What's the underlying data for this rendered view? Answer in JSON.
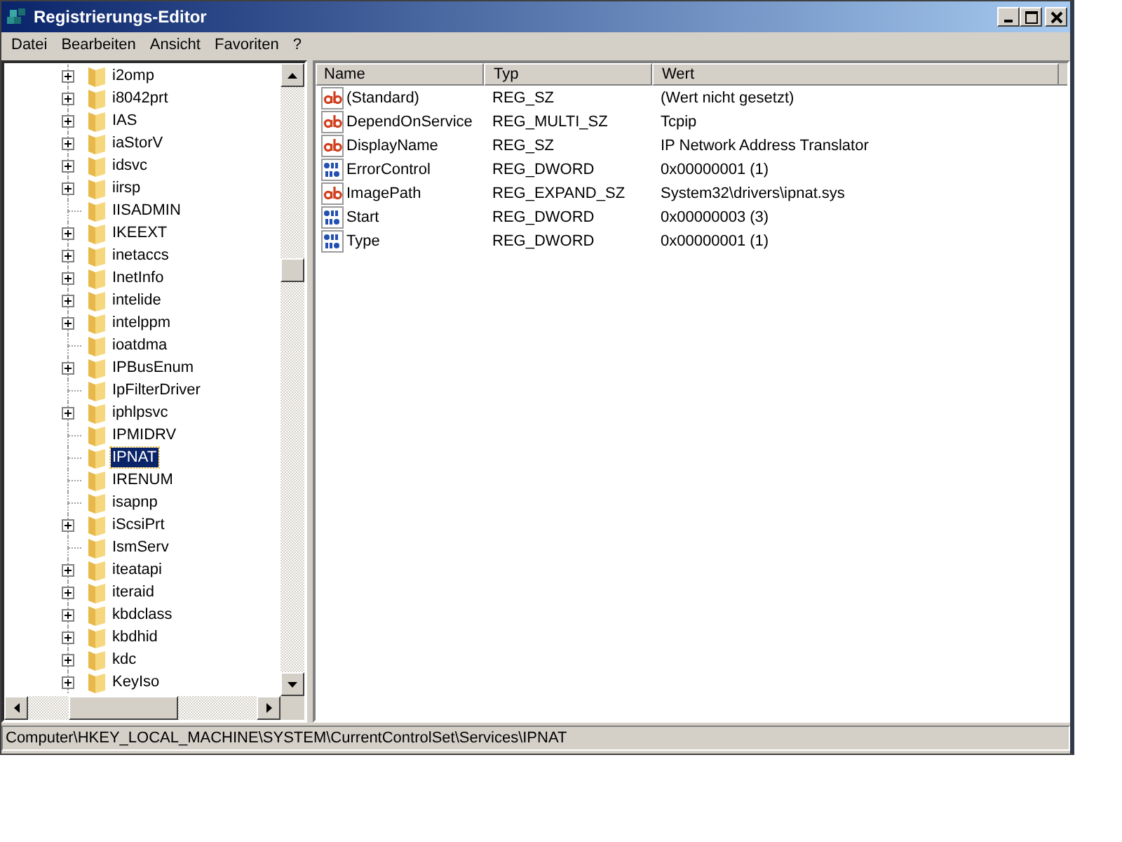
{
  "window": {
    "title": "Registrierungs-Editor"
  },
  "menu": [
    "Datei",
    "Bearbeiten",
    "Ansicht",
    "Favoriten",
    "?"
  ],
  "tree": [
    {
      "label": "i2omp",
      "expandable": true,
      "selected": false
    },
    {
      "label": "i8042prt",
      "expandable": true,
      "selected": false
    },
    {
      "label": "IAS",
      "expandable": true,
      "selected": false
    },
    {
      "label": "iaStorV",
      "expandable": true,
      "selected": false
    },
    {
      "label": "idsvc",
      "expandable": true,
      "selected": false
    },
    {
      "label": "iirsp",
      "expandable": true,
      "selected": false
    },
    {
      "label": "IISADMIN",
      "expandable": false,
      "selected": false
    },
    {
      "label": "IKEEXT",
      "expandable": true,
      "selected": false
    },
    {
      "label": "inetaccs",
      "expandable": true,
      "selected": false
    },
    {
      "label": "InetInfo",
      "expandable": true,
      "selected": false
    },
    {
      "label": "intelide",
      "expandable": true,
      "selected": false
    },
    {
      "label": "intelppm",
      "expandable": true,
      "selected": false
    },
    {
      "label": "ioatdma",
      "expandable": false,
      "selected": false
    },
    {
      "label": "IPBusEnum",
      "expandable": true,
      "selected": false
    },
    {
      "label": "IpFilterDriver",
      "expandable": false,
      "selected": false
    },
    {
      "label": "iphlpsvc",
      "expandable": true,
      "selected": false
    },
    {
      "label": "IPMIDRV",
      "expandable": false,
      "selected": false
    },
    {
      "label": "IPNAT",
      "expandable": false,
      "selected": true
    },
    {
      "label": "IRENUM",
      "expandable": false,
      "selected": false
    },
    {
      "label": "isapnp",
      "expandable": false,
      "selected": false
    },
    {
      "label": "iScsiPrt",
      "expandable": true,
      "selected": false
    },
    {
      "label": "IsmServ",
      "expandable": false,
      "selected": false
    },
    {
      "label": "iteatapi",
      "expandable": true,
      "selected": false
    },
    {
      "label": "iteraid",
      "expandable": true,
      "selected": false
    },
    {
      "label": "kbdclass",
      "expandable": true,
      "selected": false
    },
    {
      "label": "kbdhid",
      "expandable": true,
      "selected": false
    },
    {
      "label": "kdc",
      "expandable": true,
      "selected": false
    },
    {
      "label": "KeyIso",
      "expandable": true,
      "selected": false
    }
  ],
  "table": {
    "columns": [
      "Name",
      "Typ",
      "Wert"
    ],
    "rows": [
      {
        "kind": "string",
        "name": "(Standard)",
        "type": "REG_SZ",
        "value": "(Wert nicht gesetzt)"
      },
      {
        "kind": "string",
        "name": "DependOnService",
        "type": "REG_MULTI_SZ",
        "value": "Tcpip"
      },
      {
        "kind": "string",
        "name": "DisplayName",
        "type": "REG_SZ",
        "value": "IP Network Address Translator"
      },
      {
        "kind": "binary",
        "name": "ErrorControl",
        "type": "REG_DWORD",
        "value": "0x00000001 (1)"
      },
      {
        "kind": "string",
        "name": "ImagePath",
        "type": "REG_EXPAND_SZ",
        "value": "System32\\drivers\\ipnat.sys"
      },
      {
        "kind": "binary",
        "name": "Start",
        "type": "REG_DWORD",
        "value": "0x00000003 (3)"
      },
      {
        "kind": "binary",
        "name": "Type",
        "type": "REG_DWORD",
        "value": "0x00000001 (1)"
      }
    ]
  },
  "status_bar": "Computer\\HKEY_LOCAL_MACHINE\\SYSTEM\\CurrentControlSet\\Services\\IPNAT"
}
